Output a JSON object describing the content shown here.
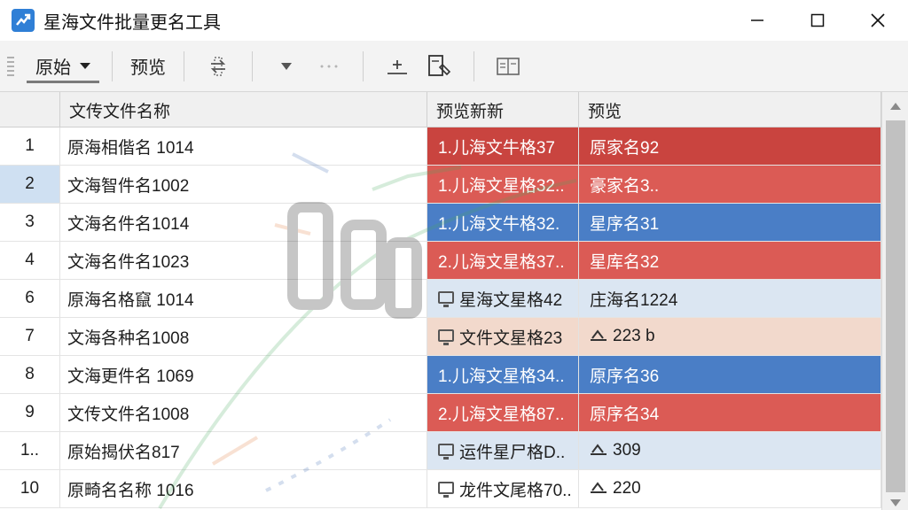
{
  "window": {
    "title": "星海文件批量更名工具",
    "icon": "trend-chart-icon",
    "controls": [
      "minimize-icon",
      "maximize-icon",
      "close-icon"
    ]
  },
  "toolbar": {
    "mode_dropdown": "原始",
    "preview_label": "预览",
    "icons": [
      "swap-icon",
      "dropdown-arrow-icon",
      "more-icon",
      "insert-icon",
      "document-edit-icon",
      "panel-icon"
    ]
  },
  "grid": {
    "columns": [
      "",
      "文传文件名称",
      "预览新新",
      "预览"
    ],
    "rows": [
      {
        "num": "1",
        "name": "原海相偕名 1014",
        "preview": "1.儿海文牛格37",
        "preview2": "原家名92",
        "style": "red",
        "icon": ""
      },
      {
        "num": "2",
        "name": "文海智件名1002",
        "preview": "1.儿海文星格32..",
        "preview2": "豪家名3..",
        "style": "redlight",
        "icon": ""
      },
      {
        "num": "3",
        "name": "文海名件名1014",
        "preview": "1.儿海文牛格32.",
        "preview2": "星序名31",
        "style": "blue",
        "icon": ""
      },
      {
        "num": "4",
        "name": "文海名件名1023",
        "preview": "2.儿海文星格37..",
        "preview2": "星库名32",
        "style": "redlight",
        "icon": ""
      },
      {
        "num": "6",
        "name": "原海名格竄 1014",
        "preview": "星海文星格42",
        "preview2": "庄海名1224",
        "style": "pale",
        "icon": "monitor-icon"
      },
      {
        "num": "7",
        "name": "文海各种名1008",
        "preview": "文件文星格23",
        "preview2": "223 b",
        "style": "peach",
        "icon": "monitor-icon"
      },
      {
        "num": "8",
        "name": "文海更件名 1069",
        "preview": "1.儿海文星格34..",
        "preview2": "原序名36",
        "style": "blue",
        "icon": ""
      },
      {
        "num": "9",
        "name": "文传文件名1008",
        "preview": "2.儿海文星格87..",
        "preview2": "原序名34",
        "style": "redlight",
        "icon": ""
      },
      {
        "num": "1..",
        "name": "原始揭伏名817",
        "preview": "运件星尸格D..",
        "preview2": "309",
        "style": "pale",
        "icon": "monitor-icon"
      },
      {
        "num": "10",
        "name": "原畸名名称 1016",
        "preview": "龙件文尾格70..",
        "preview2": "220",
        "style": "white",
        "icon": "monitor-icon"
      }
    ]
  },
  "colors": {
    "red": "#c9443f",
    "redlight": "#db5b55",
    "blue": "#4a7ec6",
    "pale": "#dbe6f2",
    "peach": "#f2d9cc",
    "accent": "#2f7fd6"
  }
}
